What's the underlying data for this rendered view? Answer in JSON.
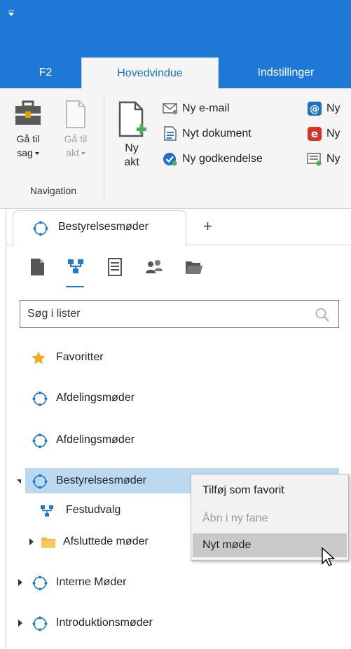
{
  "ribbon": {
    "tabs": [
      "F2",
      "Hovedvindue",
      "Indstillinger"
    ],
    "navigation": {
      "goto_case": {
        "line1": "Gå til",
        "line2": "sag"
      },
      "goto_doc": {
        "line1": "Gå til",
        "line2": "akt"
      },
      "group_label": "Navigation"
    },
    "new_doc": {
      "line1": "Ny",
      "line2": "akt"
    },
    "small_items": [
      "Ny e-mail",
      "Nyt dokument",
      "Ny godkendelse"
    ],
    "cut_items": [
      "Ny",
      "Ny",
      "Ny"
    ]
  },
  "doc_tab": {
    "label": "Bestyrelsesmøder"
  },
  "search": {
    "placeholder": "Søg i lister"
  },
  "tree": {
    "favorites": "Favoritter",
    "items": [
      "Afdelingsmøder",
      "Afdelingsmøder",
      "Bestyrelsesmøder",
      "Festudvalg",
      "Afsluttede møder",
      "Interne Møder",
      "Introduktionsmøder"
    ]
  },
  "context_menu": {
    "items": [
      "Tilføj som favorit",
      "Åbn i ny fane",
      "Nyt møde"
    ]
  },
  "colors": {
    "accent": "#1e78d6",
    "selected": "#bcd9f2",
    "ribbon_bg": "#f5f5f5"
  }
}
